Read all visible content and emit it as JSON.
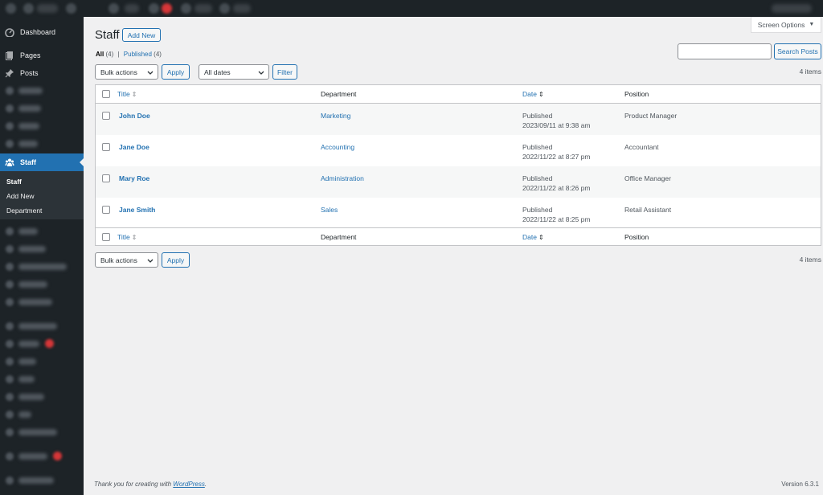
{
  "sidebar": {
    "dashboard": "Dashboard",
    "pages": "Pages",
    "posts": "Posts",
    "staff": "Staff",
    "submenu": [
      "Staff",
      "Add New",
      "Department"
    ]
  },
  "header": {
    "screen_options": "Screen Options",
    "title": "Staff",
    "add_new": "Add New"
  },
  "views": {
    "all_label": "All",
    "all_count": "(4)",
    "separator": "|",
    "published_label": "Published",
    "published_count": "(4)"
  },
  "filters": {
    "bulk_actions": "Bulk actions",
    "apply": "Apply",
    "all_dates": "All dates",
    "filter": "Filter",
    "search_button": "Search Posts",
    "items": "4 items"
  },
  "table": {
    "columns": {
      "title": "Title",
      "department": "Department",
      "date": "Date",
      "position": "Position"
    },
    "rows": [
      {
        "title": "John Doe",
        "department": "Marketing",
        "status": "Published",
        "date": "2023/09/11 at 9:38 am",
        "position": "Product Manager"
      },
      {
        "title": "Jane Doe",
        "department": "Accounting",
        "status": "Published",
        "date": "2022/11/22 at 8:27 pm",
        "position": "Accountant"
      },
      {
        "title": "Mary Roe",
        "department": "Administration",
        "status": "Published",
        "date": "2022/11/22 at 8:26 pm",
        "position": "Office Manager"
      },
      {
        "title": "Jane Smith",
        "department": "Sales",
        "status": "Published",
        "date": "2022/11/22 at 8:25 pm",
        "position": "Retail Assistant"
      }
    ]
  },
  "footer": {
    "thanks_prefix": "Thank you for creating with ",
    "wordpress": "WordPress",
    "thanks_suffix": ".",
    "version": "Version 6.3.1"
  },
  "colors": {
    "accent": "#2271b1",
    "sidebar_bg": "#1d2327",
    "page_bg": "#f0f0f1"
  }
}
